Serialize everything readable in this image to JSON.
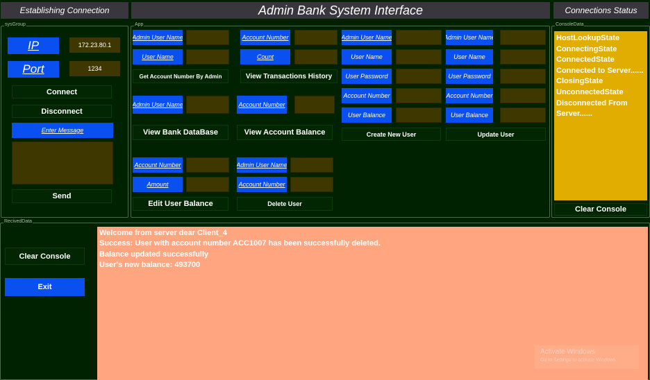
{
  "header": {
    "left": "Establishing Connection",
    "center": "Admin Bank System Interface",
    "right": "Connections Status"
  },
  "sysGroup": {
    "label": "sysGroup",
    "ip_label": "IP",
    "ip_value": "172.23.80.1",
    "port_label": "Port",
    "port_value": "1234",
    "connect": "Connect",
    "disconnect": "Disconnect",
    "enter_message": "Enter Message",
    "send": "Send"
  },
  "app": {
    "label": "App",
    "get_account": {
      "field": "Admin User Name",
      "user_name": "User Name",
      "button": "Get Account Number By Admin"
    },
    "transactions": {
      "account_number": "Account Number",
      "count": "Count",
      "button": "View Transactions History"
    },
    "create_user": {
      "admin": "Admin User Name",
      "user_name": "User Name",
      "password": "User Password",
      "account_number": "Account Number",
      "balance": "User Balance",
      "button": "Create New User"
    },
    "update_user": {
      "admin": "Admin User Name",
      "user_name": "User Name",
      "password": "User Password",
      "account_number": "Account Number",
      "balance": "User Balance",
      "button": "Update User"
    },
    "view_db": {
      "field": "Admin User Name",
      "button": "View Bank DataBase"
    },
    "view_balance": {
      "field": "Account Number",
      "button": "View Account Balance"
    },
    "edit_balance": {
      "account_number": "Account Number",
      "amount": "Amount",
      "button": "Edit User Balance"
    },
    "delete_user": {
      "admin": "Admin User Name",
      "account_number": "Account Number",
      "button": "Delete User"
    }
  },
  "consoleData": {
    "label": "ConsoleData",
    "lines": [
      "HostLookupState",
      "ConnectingState",
      "ConnectedState",
      "Connected to Server......",
      "ClosingState",
      "UnconnectedState",
      "Disconnected From",
      "Server......"
    ],
    "clear": "Clear Console"
  },
  "received": {
    "label": "RecivedData",
    "clear": "Clear Console",
    "exit": "Exit",
    "lines": [
      "Welcome from server dear Client_4",
      "Success: User with account number ACC1007 has been successfully deleted.",
      "Balance updated successfully",
      "User's new balance: 493700"
    ]
  },
  "watermark": {
    "title": "Activate Windows",
    "subtitle": "Go to Settings to activate Windows."
  },
  "colors": {
    "background": "#002200",
    "header": "#3a363d",
    "blue": "#0a4ff0",
    "olive_input": "#3f3700",
    "console_panel": "#e0ad00",
    "received_panel": "#ffa680"
  }
}
